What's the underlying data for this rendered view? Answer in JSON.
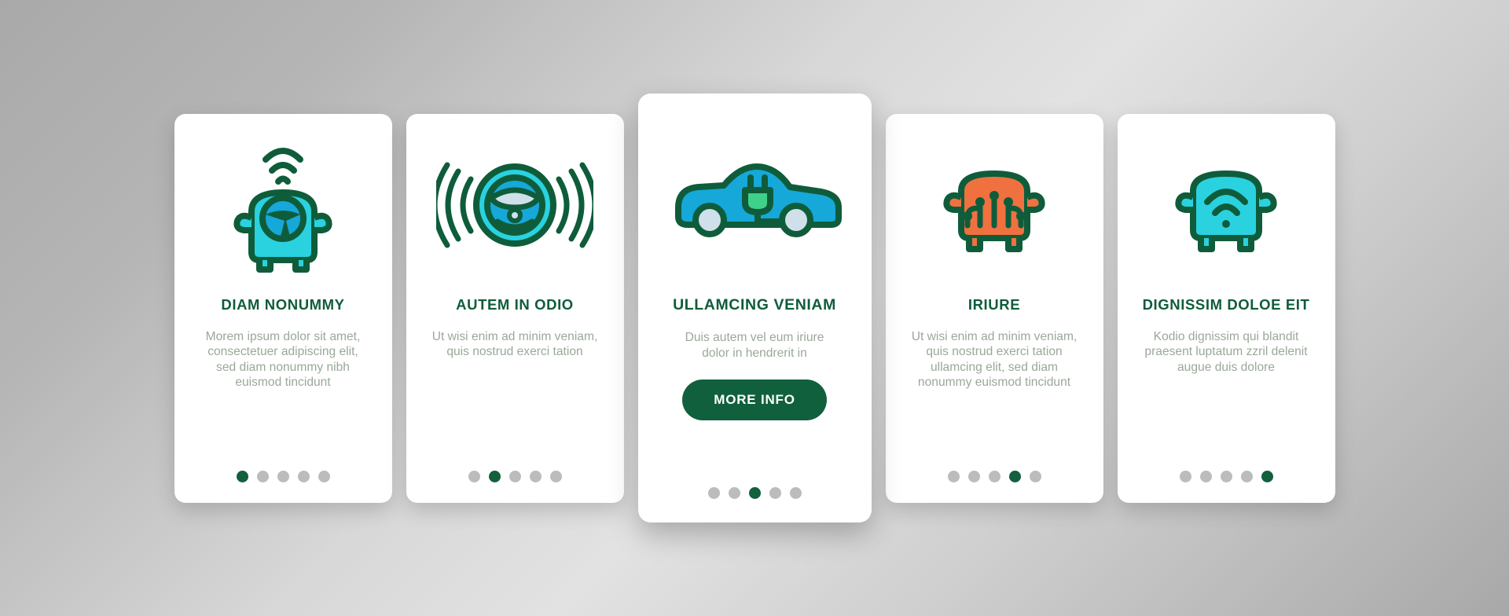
{
  "theme": {
    "dark_green": "#0f5c3b",
    "body_text": "#9aa89a",
    "cyan": "#2ad2e0",
    "blue": "#16a8d8",
    "orange": "#f0713f",
    "dot_inactive": "#bcbcbc",
    "dot_active": "#12603d",
    "card_bg": "#ffffff"
  },
  "cards": [
    {
      "icon": "car-front-wifi-steering-icon",
      "title": "DIAM NONUMMY",
      "body": "Morem ipsum dolor sit amet, consectetuer adipiscing elit, sed diam nonummy nibh euismod tincidunt",
      "dots": {
        "count": 5,
        "active_index": 0
      },
      "featured": false,
      "button": null
    },
    {
      "icon": "steering-wheel-signal-icon",
      "title": "AUTEM IN ODIO",
      "body": "Ut wisi enim ad minim veniam, quis nostrud exerci tation",
      "dots": {
        "count": 5,
        "active_index": 1
      },
      "featured": false,
      "button": null
    },
    {
      "icon": "electric-car-plug-icon",
      "title": "ULLAMCING VENIAM",
      "body": "Duis autem vel eum iriure dolor in hendrerit in",
      "dots": {
        "count": 5,
        "active_index": 2
      },
      "featured": true,
      "button": "MORE INFO"
    },
    {
      "icon": "car-front-circuit-icon",
      "title": "IRIURE",
      "body": "Ut wisi enim ad minim veniam, quis nostrud exerci tation ullamcing elit, sed diam nonummy euismod tincidunt",
      "dots": {
        "count": 5,
        "active_index": 3
      },
      "featured": false,
      "button": null
    },
    {
      "icon": "car-front-wifi-icon",
      "title": "DIGNISSIM DOLOE EIT",
      "body": "Kodio dignissim qui blandit praesent luptatum zzril delenit augue duis dolore",
      "dots": {
        "count": 5,
        "active_index": 4
      },
      "featured": false,
      "button": null
    }
  ]
}
